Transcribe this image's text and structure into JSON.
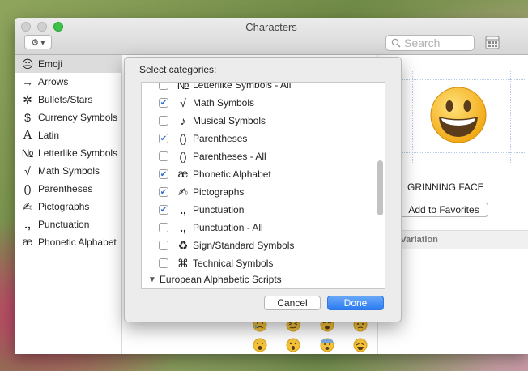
{
  "window": {
    "title": "Characters"
  },
  "toolbar": {
    "gear_label": "⚙",
    "search_placeholder": "Search"
  },
  "sidebar": {
    "items": [
      {
        "icon": "😐",
        "label": "Emoji"
      },
      {
        "icon": "→",
        "label": "Arrows"
      },
      {
        "icon": "✲",
        "label": "Bullets/Stars"
      },
      {
        "icon": "$",
        "label": "Currency Symbols"
      },
      {
        "icon": "A",
        "label": "Latin"
      },
      {
        "icon": "№",
        "label": "Letterlike Symbols"
      },
      {
        "icon": "√",
        "label": "Math Symbols"
      },
      {
        "icon": "()",
        "label": "Parentheses"
      },
      {
        "icon": "✍",
        "label": "Pictographs"
      },
      {
        "icon": ".,",
        "label": "Punctuation"
      },
      {
        "icon": "æ",
        "label": "Phonetic Alphabet"
      }
    ]
  },
  "detail": {
    "char_name": "GRINNING FACE",
    "add_favorites_label": "Add to Favorites",
    "variation_header": "nt Variation"
  },
  "popover": {
    "title": "Select categories:",
    "rows": [
      {
        "checked": false,
        "glyph": "№",
        "label": "Letterlike Symbols - All"
      },
      {
        "checked": true,
        "glyph": "√",
        "label": "Math Symbols"
      },
      {
        "checked": false,
        "glyph": "♪",
        "label": "Musical Symbols"
      },
      {
        "checked": true,
        "glyph": "()",
        "label": "Parentheses"
      },
      {
        "checked": false,
        "glyph": "()",
        "label": "Parentheses - All"
      },
      {
        "checked": true,
        "glyph": "æ",
        "label": "Phonetic Alphabet"
      },
      {
        "checked": true,
        "glyph": "✍",
        "label": "Pictographs"
      },
      {
        "checked": true,
        "glyph": ".,",
        "label": "Punctuation"
      },
      {
        "checked": false,
        "glyph": ".,",
        "label": "Punctuation - All"
      },
      {
        "checked": false,
        "glyph": "♻",
        "label": "Sign/Standard Symbols"
      },
      {
        "checked": false,
        "glyph": "⌘",
        "label": "Technical Symbols"
      }
    ],
    "group_label": "European Alphabetic Scripts",
    "cancel_label": "Cancel",
    "done_label": "Done"
  }
}
